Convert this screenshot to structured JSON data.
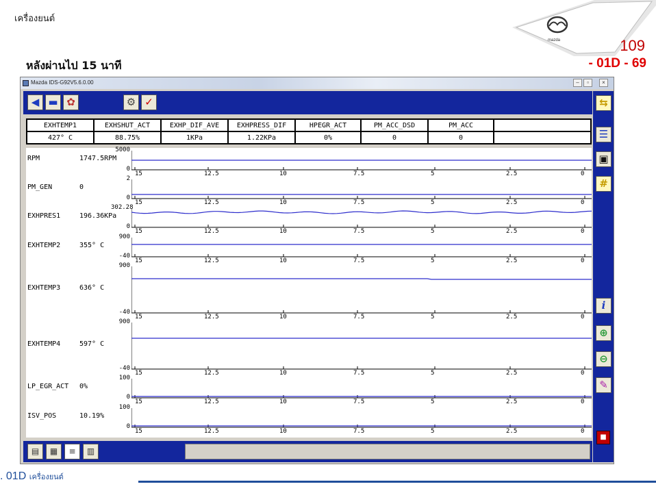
{
  "slide": {
    "header": "เครื่องยนต์",
    "page_number": "109",
    "page_code": "- 01D - 69",
    "subtitle": "หลังผ่านไป 15 นาที",
    "footer_code": ". 01D",
    "footer_label": "เครื่องยนต์",
    "brand": "mazda"
  },
  "window": {
    "title": "Mazda IDS-G92V5.6.0.00",
    "controls": [
      "minimize",
      "restore",
      "close"
    ]
  },
  "toolbar": {
    "icons": [
      "back-arrow-icon",
      "vehicle-icon",
      "engine-icon",
      "datalogger-icon",
      "dtc-icon"
    ]
  },
  "pid_table": {
    "headers": [
      "EXHTEMP1",
      "EXHSHUT_ACT",
      "EXHP_DIF_AVE",
      "EXHPRESS_DIF",
      "HPEGR_ACT",
      "PM_ACC_DSD",
      "PM_ACC"
    ],
    "values": [
      "427° C",
      "88.75%",
      "1KPa",
      "1.22KPa",
      "0%",
      "0",
      "0"
    ]
  },
  "x_ticks": [
    "15",
    "12.5",
    "10",
    "7.5",
    "5",
    "2.5",
    "0"
  ],
  "graphs": [
    {
      "label": "RPM",
      "value": "1747.5RPM",
      "max": "5000",
      "min": "0"
    },
    {
      "label": "PM_GEN",
      "value": "0",
      "max": "2",
      "min": "0"
    },
    {
      "label": "EXHPRES1",
      "value": "196.36KPa",
      "max": "302.28",
      "min": "0"
    },
    {
      "label": "EXHTEMP2",
      "value": "355° C",
      "max": "900",
      "min": "-40"
    },
    {
      "label": "EXHTEMP3",
      "value": "636° C",
      "max": "900",
      "min": "-40"
    },
    {
      "label": "EXHTEMP4",
      "value": "597° C",
      "max": "900",
      "min": "-40"
    },
    {
      "label": "LP_EGR_ACT",
      "value": "0%",
      "max": "100",
      "min": "0"
    },
    {
      "label": "ISV_POS",
      "value": "10.19%",
      "max": "100",
      "min": "0"
    }
  ],
  "side_tools": [
    "list-icon",
    "camera-icon",
    "grid-icon",
    "info-icon",
    "zoom-in-icon",
    "zoom-out-icon",
    "print-icon"
  ],
  "bottom_tools": [
    "tool-a-icon",
    "tool-b-icon",
    "graph-view-icon",
    "table-view-icon"
  ],
  "colors": {
    "panel_blue": "#13269d",
    "trace": "#2c2ccc",
    "accent_red": "#e00000",
    "footer_blue": "#1f4e9a"
  }
}
